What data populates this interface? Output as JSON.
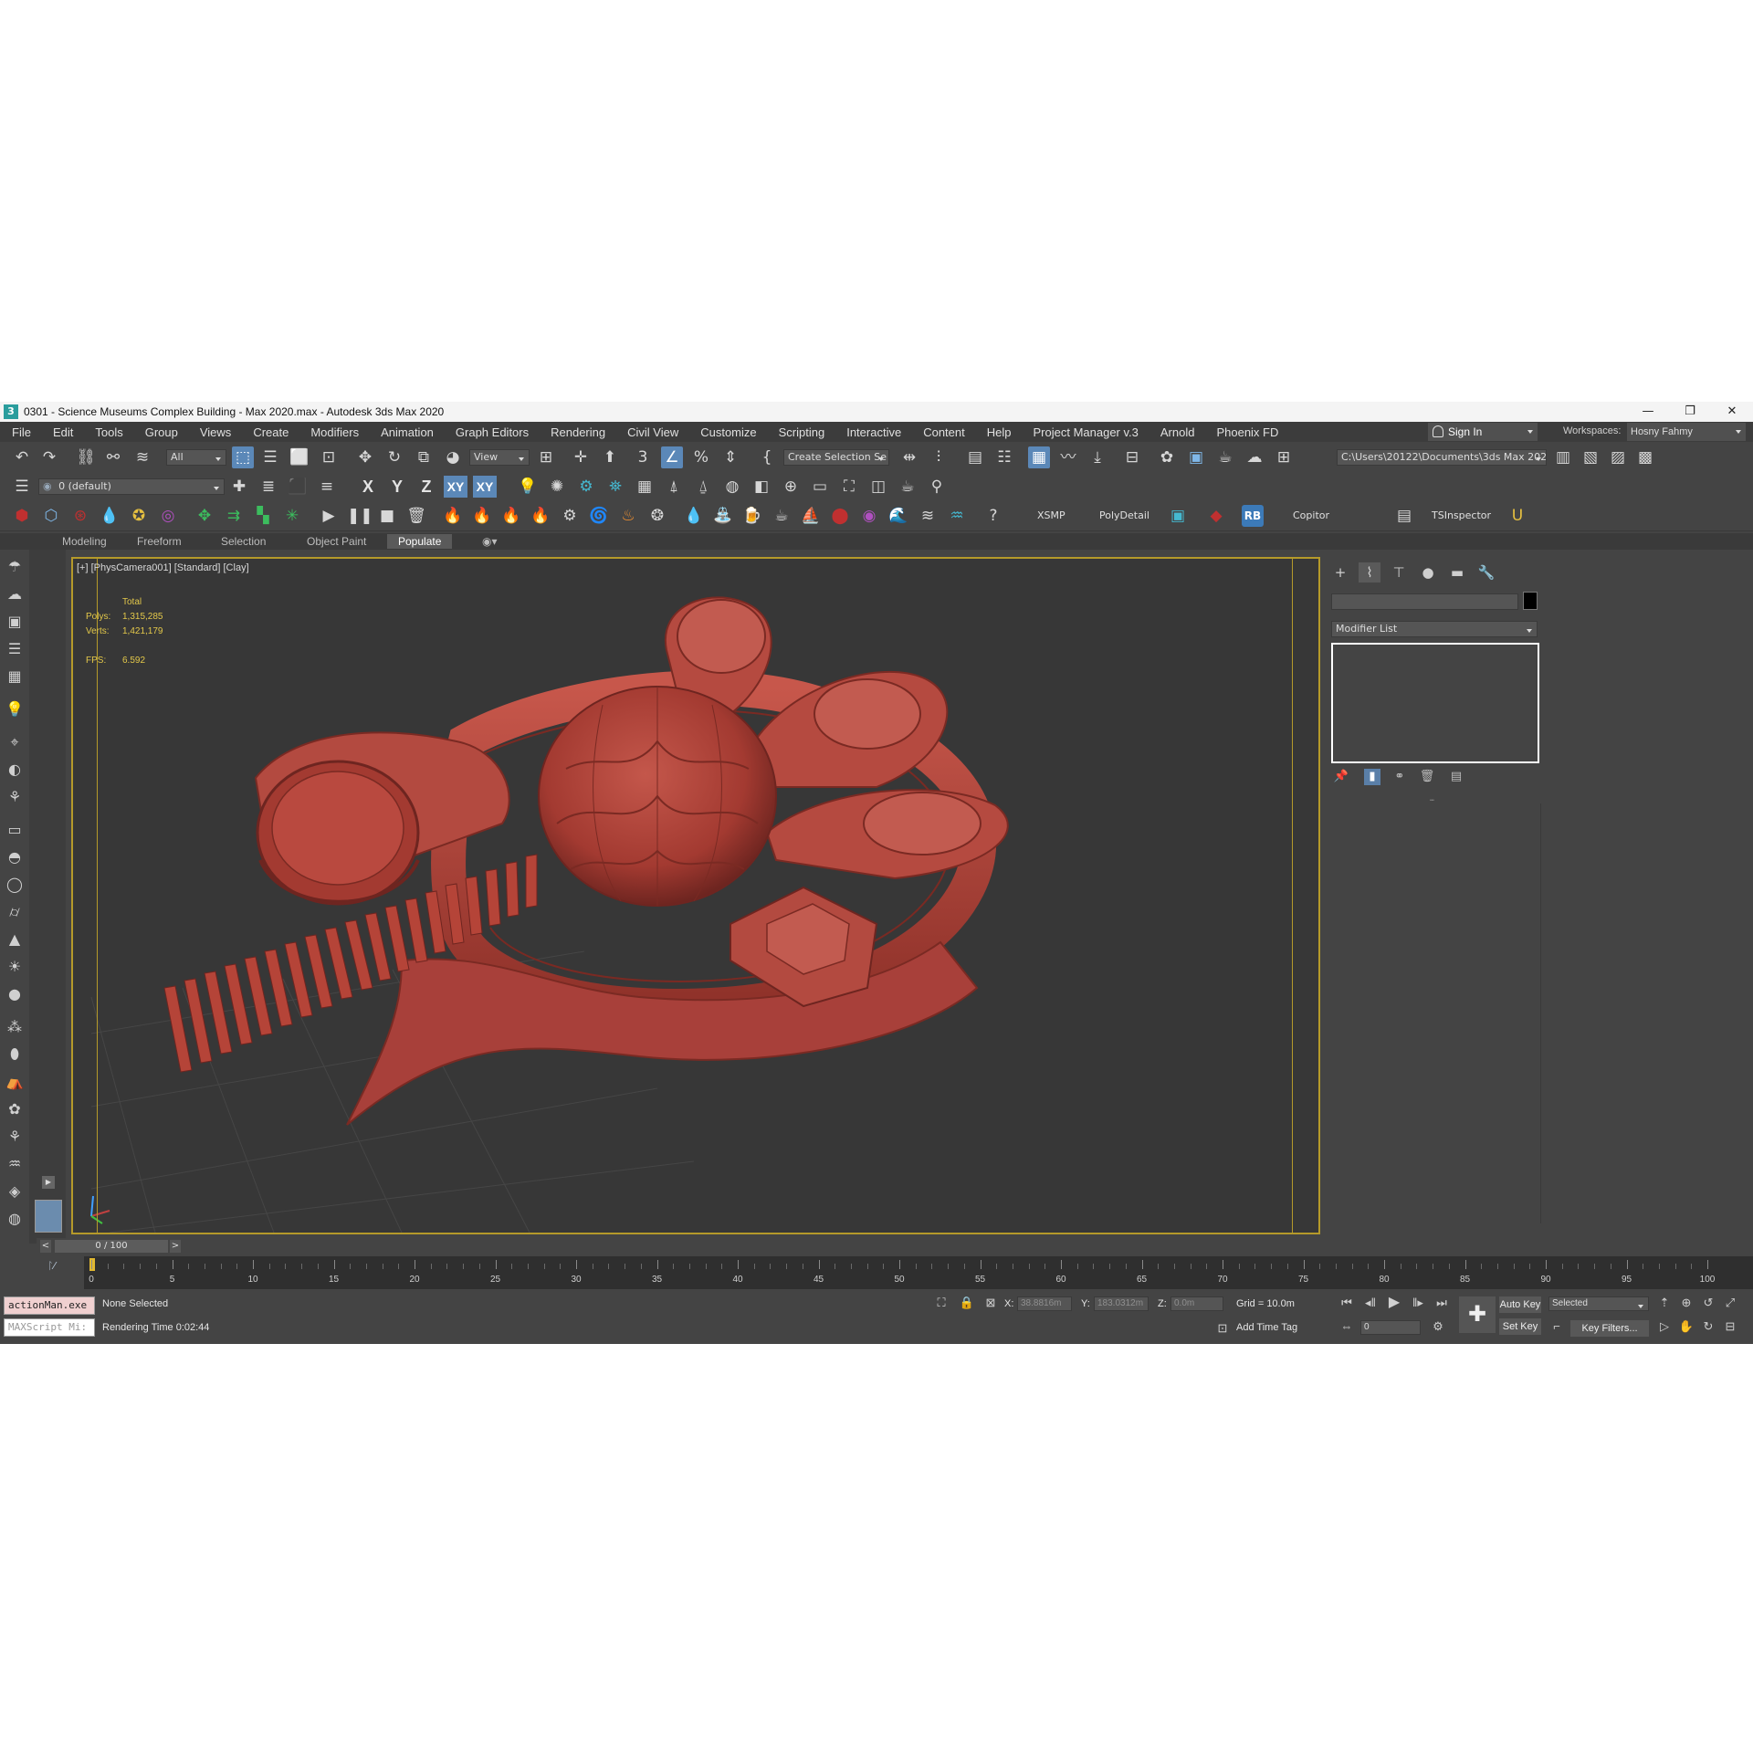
{
  "window": {
    "title": "0301 - Science Museums Complex Building - Max 2020.max - Autodesk 3ds Max 2020",
    "app_icon": "3",
    "minimize": "—",
    "restore": "❐",
    "close": "✕"
  },
  "menu": {
    "items": [
      "File",
      "Edit",
      "Tools",
      "Group",
      "Views",
      "Create",
      "Modifiers",
      "Animation",
      "Graph Editors",
      "Rendering",
      "Civil View",
      "Customize",
      "Scripting",
      "Interactive",
      "Content",
      "Help",
      "Project Manager v.3",
      "Arnold",
      "Phoenix FD"
    ],
    "sign_in": "Sign In",
    "workspaces_label": "Workspaces:",
    "workspace": "Hosny Fahmy"
  },
  "main_toolbar": {
    "selection_filter": "All",
    "ref_coord": "View",
    "named_selection": "Create Selection Se",
    "project_path": "C:\\Users\\20122\\Documents\\3ds Max 2020"
  },
  "layer_toolbar": {
    "layer": "0 (default)",
    "axes": [
      "X",
      "Y",
      "Z",
      "XY",
      "XY"
    ]
  },
  "plugin_toolbar": {
    "xsmp": "XSMP",
    "polydetail": "PolyDetail",
    "rb": "RB",
    "copitor": "Copitor",
    "tsinspector": "TSInspector"
  },
  "ribbon": {
    "tabs": [
      "Modeling",
      "Freeform",
      "Selection",
      "Object Paint",
      "Populate"
    ],
    "active": "Populate"
  },
  "viewport": {
    "label": "[+] [PhysCamera001] [Standard] [Clay]",
    "stats_total": "Total",
    "polys_label": "Polys:",
    "polys": "1,315,285",
    "verts_label": "Verts:",
    "verts": "1,421,179",
    "fps_label": "FPS:",
    "fps": "6.592",
    "model_color": "#b8463c",
    "background_color": "#373737",
    "frame_color": "#b59a2a"
  },
  "command_panel": {
    "modifier_list": "Modifier List"
  },
  "timeline": {
    "frame": "0 / 100",
    "ticks": [
      "0",
      "5",
      "10",
      "15",
      "20",
      "25",
      "30",
      "35",
      "40",
      "45",
      "50",
      "55",
      "60",
      "65",
      "70",
      "75",
      "80",
      "85",
      "90",
      "95",
      "100"
    ]
  },
  "status": {
    "listener_top": "actionMan.exe",
    "listener_bottom": "MAXScript Mi:",
    "selection": "None Selected",
    "render_time": "Rendering Time  0:02:44",
    "x_label": "X:",
    "x": "38.8816m",
    "y_label": "Y:",
    "y": "183.0312m",
    "z_label": "Z:",
    "z": "0.0m",
    "grid": "Grid = 10.0m",
    "add_time_tag": "Add Time Tag",
    "auto_key": "Auto Key",
    "set_key": "Set Key",
    "key_mode": "Selected",
    "frame_field": "0",
    "key_filters": "Key Filters..."
  }
}
